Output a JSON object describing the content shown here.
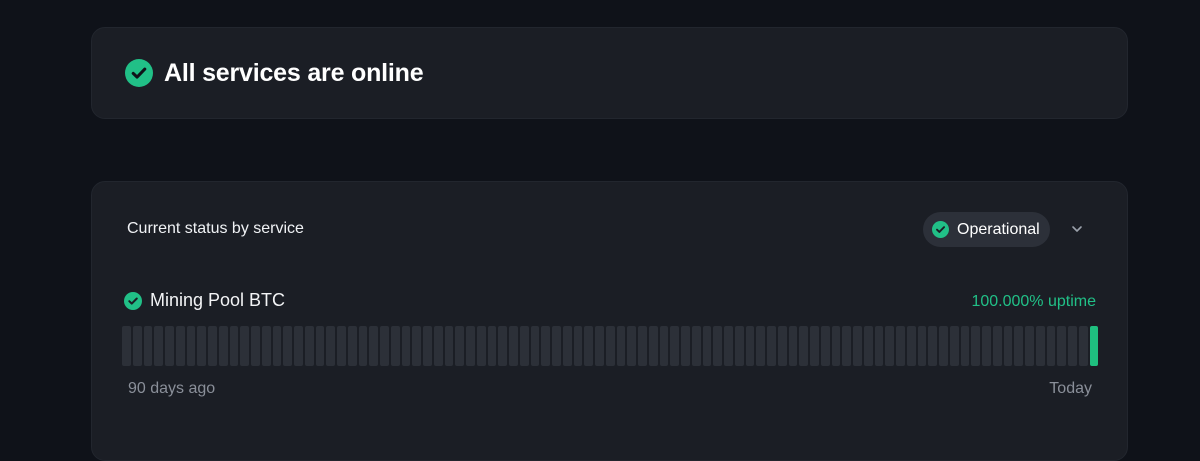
{
  "banner": {
    "title": "All services are online",
    "icon": "check-circle-icon",
    "color": "#21c087"
  },
  "status_panel": {
    "title": "Current status by service",
    "filter": {
      "label": "Operational",
      "icon": "check-circle-icon",
      "dropdown_icon": "chevron-down-icon"
    },
    "services": [
      {
        "name": "Mining Pool BTC",
        "icon": "check-circle-icon",
        "uptime": "100.000% uptime",
        "bar_count": 91,
        "highlighted_bar": "latest",
        "range_start": "90 days ago",
        "range_end": "Today"
      }
    ]
  },
  "colors": {
    "background": "#0f1219",
    "card": "#1b1e25",
    "accent_green": "#21c087",
    "bar_empty": "#2c3038",
    "muted_text": "#8a8f99"
  }
}
